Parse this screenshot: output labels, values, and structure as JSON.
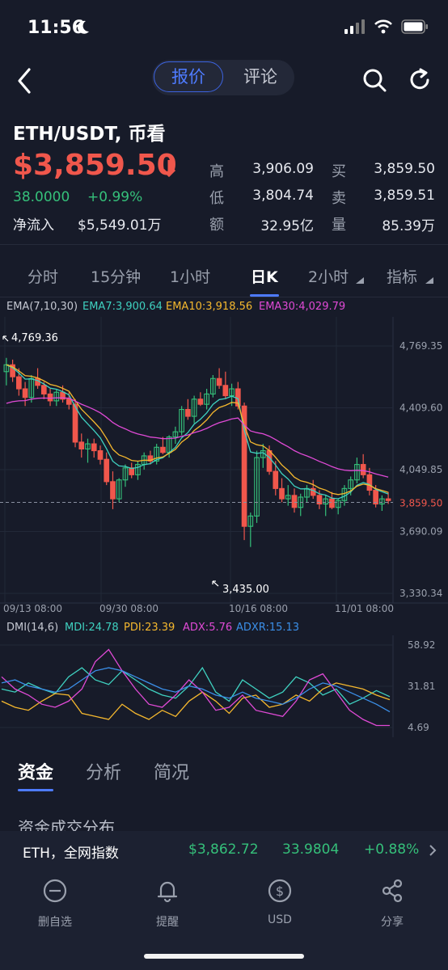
{
  "status": {
    "time": "11:56"
  },
  "nav": {
    "tab_quote": "报价",
    "tab_comment": "评论"
  },
  "header": {
    "pair": "ETH/USDT, 币看",
    "price": "$3,859.50",
    "change_abs": "38.0000",
    "change_pct": "+0.99%",
    "inflow_label": "净流入",
    "inflow_value": "$5,549.01万"
  },
  "stats": {
    "high_label": "高",
    "high": "3,906.09",
    "low_label": "低",
    "low": "3,804.74",
    "amount_label": "额",
    "amount": "32.95亿",
    "buy_label": "买",
    "buy": "3,859.50",
    "sell_label": "卖",
    "sell": "3,859.51",
    "volume_label": "量",
    "volume": "85.39万"
  },
  "period_tabs": [
    "分时",
    "15分钟",
    "1小时",
    "日K",
    "2小时",
    "指标"
  ],
  "active_period": "日K",
  "colors": {
    "up": "#35c07a",
    "down": "#f0574c",
    "accent": "#4e7bff",
    "ema7": "#3fd1c0",
    "ema10": "#f5b82e",
    "ema30": "#e04ad6",
    "adxr": "#3b8fe8"
  },
  "chart_data": [
    {
      "type": "candlestick",
      "legend": {
        "name": "EMA(7,10,30)",
        "ema7": "EMA7:3,900.64",
        "ema10": "EMA10:3,918.56",
        "ema30": "EMA30:4,029.79"
      },
      "y_ticks": [
        "4,769.35",
        "4,409.60",
        "4,049.85",
        "3,690.09",
        "3,330.34"
      ],
      "ylim": [
        3330.34,
        4769.35
      ],
      "x_labels": [
        "09/13 08:00",
        "09/30 08:00",
        "10/16 08:00",
        "11/01 08:00"
      ],
      "current_price": "3,859.50",
      "high_marker": "4,769.36",
      "low_marker": "3,435.00",
      "candles": [
        [
          4620,
          4700,
          4540,
          4660
        ],
        [
          4660,
          4690,
          4560,
          4590
        ],
        [
          4590,
          4640,
          4480,
          4520
        ],
        [
          4520,
          4560,
          4420,
          4470
        ],
        [
          4470,
          4600,
          4440,
          4580
        ],
        [
          4580,
          4640,
          4520,
          4540
        ],
        [
          4540,
          4560,
          4460,
          4490
        ],
        [
          4490,
          4520,
          4420,
          4450
        ],
        [
          4450,
          4520,
          4420,
          4500
        ],
        [
          4500,
          4540,
          4440,
          4460
        ],
        [
          4460,
          4500,
          4400,
          4430
        ],
        [
          4430,
          4460,
          4180,
          4210
        ],
        [
          4210,
          4260,
          4120,
          4170
        ],
        [
          4170,
          4230,
          4090,
          4200
        ],
        [
          4200,
          4230,
          4120,
          4160
        ],
        [
          4160,
          4190,
          4080,
          4110
        ],
        [
          4110,
          4150,
          3960,
          3980
        ],
        [
          3980,
          4040,
          3820,
          3880
        ],
        [
          3880,
          4000,
          3860,
          3990
        ],
        [
          3990,
          4080,
          3950,
          4060
        ],
        [
          4060,
          4090,
          4000,
          4020
        ],
        [
          4020,
          4100,
          3990,
          4080
        ],
        [
          4080,
          4150,
          4050,
          4130
        ],
        [
          4130,
          4160,
          4080,
          4100
        ],
        [
          4100,
          4200,
          4080,
          4180
        ],
        [
          4180,
          4240,
          4140,
          4150
        ],
        [
          4150,
          4250,
          4120,
          4240
        ],
        [
          4240,
          4300,
          4200,
          4270
        ],
        [
          4270,
          4420,
          4250,
          4400
        ],
        [
          4400,
          4460,
          4340,
          4360
        ],
        [
          4360,
          4480,
          4320,
          4460
        ],
        [
          4460,
          4500,
          4420,
          4430
        ],
        [
          4430,
          4520,
          4400,
          4490
        ],
        [
          4490,
          4600,
          4470,
          4580
        ],
        [
          4580,
          4640,
          4520,
          4540
        ],
        [
          4540,
          4620,
          4460,
          4480
        ],
        [
          4480,
          4550,
          4420,
          4520
        ],
        [
          4520,
          4560,
          4400,
          4420
        ],
        [
          4420,
          4440,
          3640,
          3720
        ],
        [
          3720,
          3800,
          3600,
          3780
        ],
        [
          3780,
          4160,
          3740,
          4120
        ],
        [
          4120,
          4200,
          4060,
          4160
        ],
        [
          4160,
          4190,
          4020,
          4040
        ],
        [
          4040,
          4100,
          3900,
          3940
        ],
        [
          3940,
          4000,
          3860,
          3880
        ],
        [
          3880,
          3960,
          3840,
          3900
        ],
        [
          3900,
          3940,
          3800,
          3830
        ],
        [
          3830,
          3910,
          3780,
          3890
        ],
        [
          3890,
          3960,
          3860,
          3940
        ],
        [
          3940,
          3990,
          3880,
          3900
        ],
        [
          3900,
          3930,
          3820,
          3850
        ],
        [
          3850,
          3900,
          3780,
          3880
        ],
        [
          3880,
          3920,
          3820,
          3830
        ],
        [
          3830,
          3880,
          3790,
          3870
        ],
        [
          3870,
          3960,
          3840,
          3940
        ],
        [
          3940,
          4010,
          3900,
          3990
        ],
        [
          3990,
          4120,
          3970,
          4080
        ],
        [
          4080,
          4140,
          4000,
          4020
        ],
        [
          4020,
          4060,
          3900,
          3930
        ],
        [
          3930,
          3960,
          3830,
          3850
        ],
        [
          3850,
          3900,
          3810,
          3880
        ],
        [
          3880,
          3920,
          3850,
          3870
        ]
      ]
    },
    {
      "type": "line",
      "legend": {
        "name": "DMI(14,6)",
        "mdi": "MDI:24.78",
        "pdi": "PDI:23.39",
        "adx": "ADX:5.76",
        "adxr": "ADXR:15.13"
      },
      "y_ticks": [
        "58.92",
        "31.81",
        "4.69"
      ],
      "ylim": [
        4.69,
        58.92
      ],
      "series": [
        {
          "name": "MDI",
          "color": "#3fd1c0",
          "values": [
            30,
            28,
            34,
            30,
            27,
            38,
            44,
            36,
            33,
            42,
            36,
            30,
            26,
            24,
            32,
            44,
            28,
            22,
            36,
            30,
            24,
            28,
            38,
            34,
            26,
            30,
            20,
            24,
            29,
            25
          ]
        },
        {
          "name": "PDI",
          "color": "#f5b82e",
          "values": [
            22,
            18,
            16,
            22,
            27,
            26,
            14,
            12,
            10,
            20,
            14,
            10,
            16,
            12,
            22,
            28,
            22,
            14,
            24,
            26,
            18,
            20,
            26,
            22,
            30,
            34,
            32,
            30,
            26,
            23
          ]
        },
        {
          "name": "ADX",
          "color": "#e04ad6",
          "values": [
            38,
            30,
            26,
            20,
            18,
            22,
            30,
            48,
            56,
            42,
            30,
            20,
            18,
            26,
            36,
            28,
            16,
            18,
            26,
            16,
            14,
            12,
            22,
            36,
            40,
            28,
            16,
            10,
            6,
            6
          ]
        },
        {
          "name": "ADXR",
          "color": "#3b8fe8",
          "values": [
            34,
            36,
            32,
            30,
            28,
            30,
            36,
            42,
            44,
            42,
            38,
            34,
            30,
            28,
            32,
            30,
            26,
            24,
            28,
            24,
            22,
            20,
            24,
            30,
            34,
            32,
            28,
            24,
            20,
            15
          ]
        }
      ]
    }
  ],
  "bottom_tabs": [
    "资金",
    "分析",
    "简况"
  ],
  "section_title": "资金成交分布",
  "ticker": {
    "label": "ETH，全网指数",
    "price": "$3,862.72",
    "change_abs": "33.9804",
    "change_pct": "+0.88%"
  },
  "bottom_nav": [
    {
      "label": "删自选",
      "icon": "minus-circle-icon"
    },
    {
      "label": "提醒",
      "icon": "bell-icon"
    },
    {
      "label": "USD",
      "icon": "dollar-circle-icon"
    },
    {
      "label": "分享",
      "icon": "share-icon"
    }
  ]
}
